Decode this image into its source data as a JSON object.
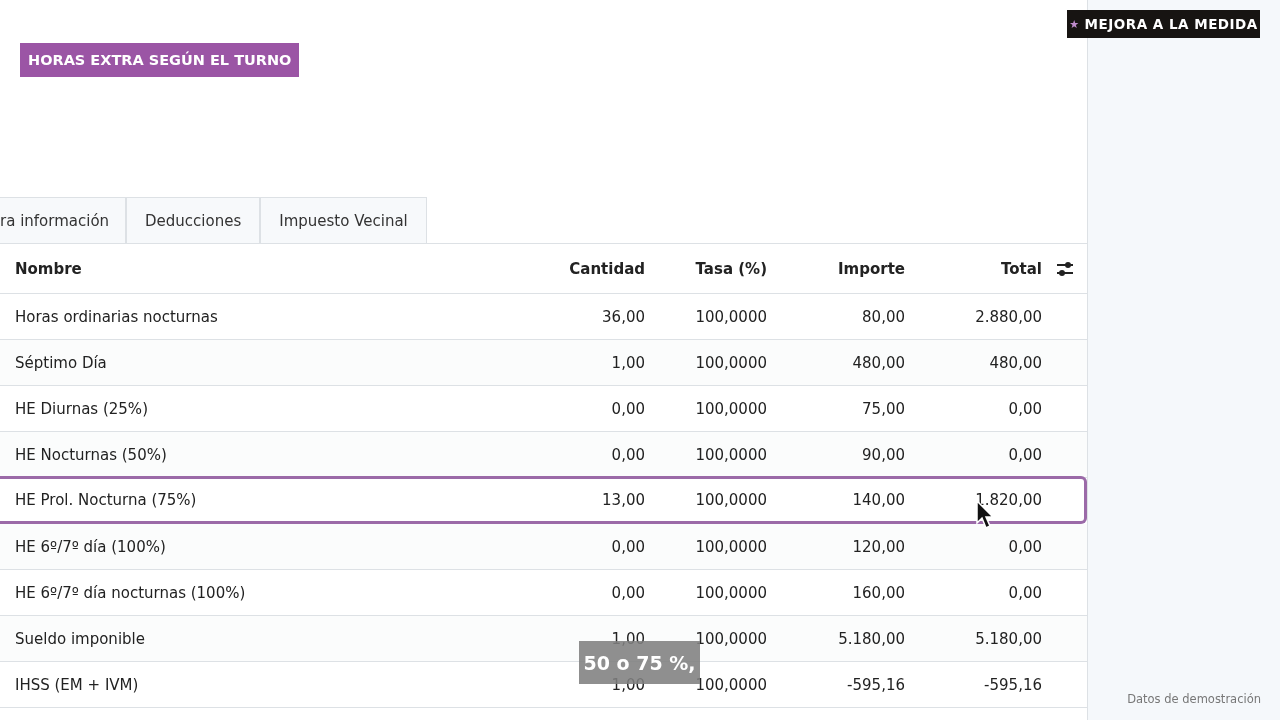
{
  "tag": {
    "label": "HORAS EXTRA SEGÚN EL TURNO"
  },
  "promo": {
    "star": "★",
    "label": "MEJORA A LA MEDIDA"
  },
  "tabs": [
    {
      "label": "ra información",
      "selected": false
    },
    {
      "label": "Deducciones",
      "selected": false
    },
    {
      "label": "Impuesto Vecinal",
      "selected": false
    }
  ],
  "table": {
    "columns": [
      "Nombre",
      "Cantidad",
      "Tasa (%)",
      "Importe",
      "Total"
    ],
    "rows": [
      {
        "cells": [
          "Horas ordinarias nocturnas",
          "36,00",
          "100,0000",
          "80,00",
          "2.880,00"
        ],
        "selected": false
      },
      {
        "cells": [
          "Séptimo Día",
          "1,00",
          "100,0000",
          "480,00",
          "480,00"
        ],
        "selected": false
      },
      {
        "cells": [
          "HE Diurnas (25%)",
          "0,00",
          "100,0000",
          "75,00",
          "0,00"
        ],
        "selected": false
      },
      {
        "cells": [
          "HE Nocturnas (50%)",
          "0,00",
          "100,0000",
          "90,00",
          "0,00"
        ],
        "selected": false
      },
      {
        "cells": [
          "HE Prol. Nocturna (75%)",
          "13,00",
          "100,0000",
          "140,00",
          "1.820,00"
        ],
        "selected": true
      },
      {
        "cells": [
          "HE 6º/7º día (100%)",
          "0,00",
          "100,0000",
          "120,00",
          "0,00"
        ],
        "selected": false
      },
      {
        "cells": [
          "HE 6º/7º día nocturnas (100%)",
          "0,00",
          "100,0000",
          "160,00",
          "0,00"
        ],
        "selected": false
      },
      {
        "cells": [
          "Sueldo imponible",
          "1,00",
          "100,0000",
          "5.180,00",
          "5.180,00"
        ],
        "selected": false
      },
      {
        "cells": [
          "IHSS (EM + IVM)",
          "1,00",
          "100,0000",
          "-595,16",
          "-595,16"
        ],
        "selected": false
      }
    ]
  },
  "caption": "50 o 75 %,",
  "demo_note": "Datos de demostración"
}
